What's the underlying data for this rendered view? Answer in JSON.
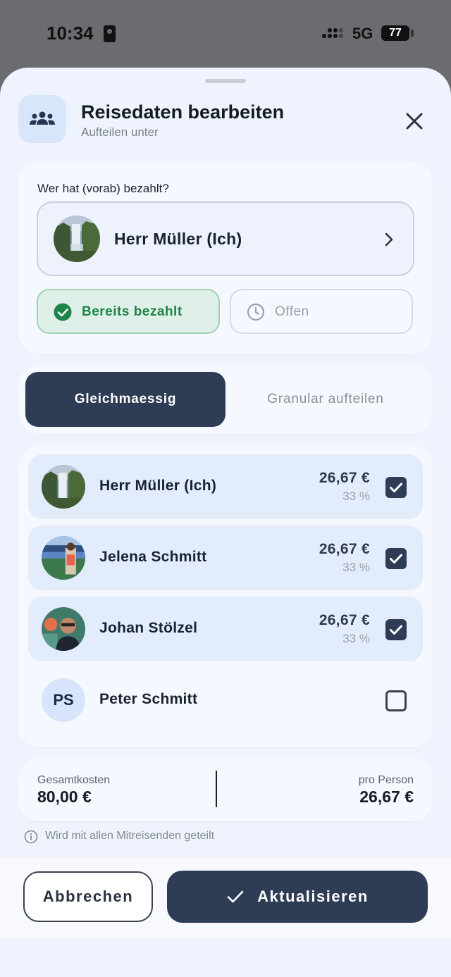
{
  "status_bar": {
    "time": "10:34",
    "network": "5G",
    "battery": "77"
  },
  "header": {
    "icon": "group-icon",
    "title": "Reisedaten bearbeiten",
    "subtitle": "Aufteilen unter",
    "close_icon": "close-icon"
  },
  "payer": {
    "label": "Wer hat (vorab) bezahlt?",
    "name": "Herr Müller (Ich)",
    "status_paid": "Bereits bezahlt",
    "status_open": "Offen",
    "selected_status": "paid"
  },
  "split_mode": {
    "tabs": [
      "Gleichmaessig",
      "Granular aufteilen"
    ],
    "active": 0
  },
  "participants": [
    {
      "name": "Herr Müller (Ich)",
      "amount": "26,67 €",
      "percent": "33 %",
      "checked": true,
      "avatar": "waterfall-photo"
    },
    {
      "name": "Jelena Schmitt",
      "amount": "26,67 €",
      "percent": "33 %",
      "checked": true,
      "avatar": "stadium-photo"
    },
    {
      "name": "Johan Stölzel",
      "amount": "26,67 €",
      "percent": "33 %",
      "checked": true,
      "avatar": "portrait-photo"
    },
    {
      "name": "Peter Schmitt",
      "initials": "PS",
      "checked": false
    }
  ],
  "summary": {
    "total_label": "Gesamtkosten",
    "total_value": "80,00 €",
    "per_person_label": "pro Person",
    "per_person_value": "26,67 €"
  },
  "info": {
    "text": "Wird mit allen Mitreisenden geteilt"
  },
  "footer": {
    "cancel_label": "Abbrechen",
    "update_label": "Aktualisieren"
  },
  "colors": {
    "primary": "#2e3d55",
    "success": "#1f8447",
    "sheet_bg": "#eef3fd"
  }
}
